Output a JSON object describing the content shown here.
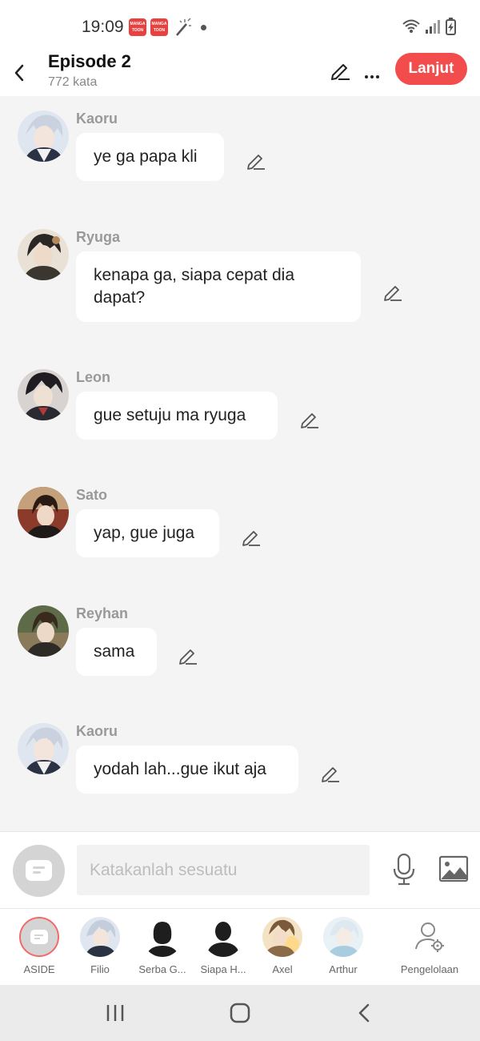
{
  "status_bar": {
    "time": "19:09",
    "notif_apps": [
      "MANGA TOON",
      "MANGA TOON"
    ]
  },
  "header": {
    "title": "Episode 2",
    "subtitle": "772 kata",
    "next_label": "Lanjut"
  },
  "messages": [
    {
      "speaker": "Kaoru",
      "text": "ye ga papa kli"
    },
    {
      "speaker": "Ryuga",
      "text": "kenapa ga, siapa cepat dia dapat?"
    },
    {
      "speaker": "Leon",
      "text": "gue setuju ma ryuga"
    },
    {
      "speaker": "Sato",
      "text": "yap, gue juga"
    },
    {
      "speaker": "Reyhan",
      "text": "sama"
    },
    {
      "speaker": "Kaoru",
      "text": "yodah lah...gue ikut aja"
    }
  ],
  "composer": {
    "placeholder": "Katakanlah sesuatu"
  },
  "characters": [
    {
      "name": "ASIDE"
    },
    {
      "name": "Filio"
    },
    {
      "name": "Serba G..."
    },
    {
      "name": "Siapa H..."
    },
    {
      "name": "Axel"
    },
    {
      "name": "Arthur"
    },
    {
      "name": "Pengelolaan"
    }
  ],
  "colors": {
    "accent": "#f24c4c",
    "background": "#f4f4f4",
    "bubble": "#ffffff"
  }
}
